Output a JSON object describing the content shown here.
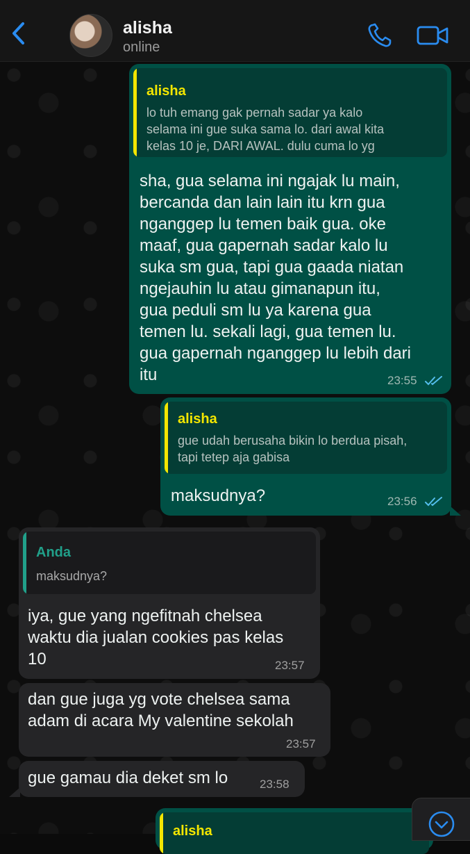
{
  "header": {
    "contact_name": "alisha",
    "status": "online",
    "icons": {
      "back": "chevron-left-icon",
      "call": "phone-icon",
      "video": "video-camera-icon"
    },
    "accent_color": "#2a8cf0"
  },
  "colors": {
    "outgoing_bubble": "#005045",
    "incoming_bubble": "#252527",
    "quote_name_outgoing": "#f3e600",
    "quote_name_incoming": "#21a08a",
    "read_ticks": "#53bdeb"
  },
  "messages": [
    {
      "direction": "outgoing",
      "quote_author": "alisha",
      "quote_lines": [
        "lo tuh emang gak pernah sadar ya kalo",
        "selama ini gue suka sama lo. dari awal kita",
        "kelas 10 je, DARI AWAL. dulu cuma lo yg"
      ],
      "text_lines": [
        "sha, gua selama ini ngajak lu main,",
        "bercanda dan lain lain itu krn gua",
        "nganggep lu temen baik gua. oke",
        "maaf, gua gapernah sadar kalo lu",
        "suka sm gua, tapi gua gaada niatan",
        "ngejauhin lu atau gimanapun itu,",
        "gua peduli sm lu ya karena gua",
        "temen lu. sekali lagi, gua temen lu.",
        "gua gapernah nganggep lu lebih dari",
        "itu"
      ],
      "time": "23:55",
      "status": "read"
    },
    {
      "direction": "outgoing",
      "quote_author": "alisha",
      "quote_lines": [
        "gue udah berusaha bikin lo berdua pisah,",
        "tapi tetep aja gabisa"
      ],
      "text_lines": [
        "maksudnya?"
      ],
      "time": "23:56",
      "status": "read"
    },
    {
      "direction": "incoming",
      "quote_author": "Anda",
      "quote_lines": [
        "maksudnya?"
      ],
      "text_lines": [
        "iya, gue yang ngefitnah chelsea",
        "waktu dia jualan cookies pas kelas",
        "10"
      ],
      "time": "23:57"
    },
    {
      "direction": "incoming",
      "text_lines": [
        "dan gue juga yg vote chelsea sama",
        "adam di acara My valentine sekolah"
      ],
      "time": "23:57"
    },
    {
      "direction": "incoming",
      "text_lines": [
        "gue gamau dia deket sm lo"
      ],
      "time": "23:58"
    },
    {
      "direction": "outgoing",
      "quote_author": "alisha",
      "partial": true
    }
  ],
  "scroll_button": {
    "icon": "chevron-down-circle-icon"
  }
}
